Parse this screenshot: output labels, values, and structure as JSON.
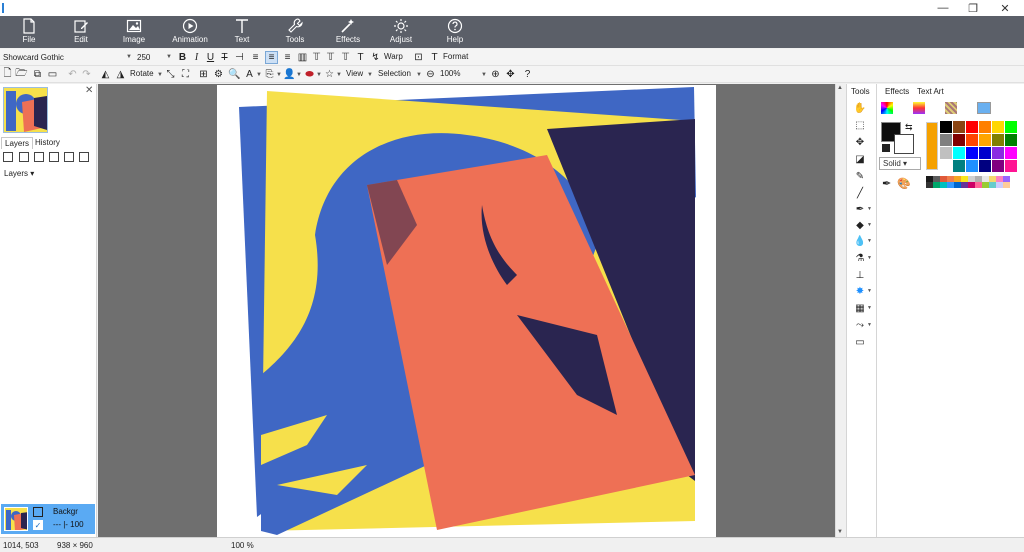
{
  "window": {
    "min_glyph": "—",
    "max_glyph": "❐",
    "close_glyph": "✕"
  },
  "menu": {
    "items": [
      {
        "label": "File",
        "icon": "file-icon"
      },
      {
        "label": "Edit",
        "icon": "edit-icon"
      },
      {
        "label": "Image",
        "icon": "image-icon"
      },
      {
        "label": "Animation",
        "icon": "play-circle-icon"
      },
      {
        "label": "Text",
        "icon": "text-icon"
      },
      {
        "label": "Tools",
        "icon": "wrench-icon"
      },
      {
        "label": "Effects",
        "icon": "magic-wand-icon"
      },
      {
        "label": "Adjust",
        "icon": "sun-icon"
      },
      {
        "label": "Help",
        "icon": "question-icon"
      }
    ]
  },
  "text_toolbar": {
    "font": "Showcard Gothic",
    "size": "250",
    "warp_label": "Warp",
    "format_label": "Format"
  },
  "main_toolbar": {
    "rotate_label": "Rotate",
    "view_label": "View",
    "selection_label": "Selection",
    "zoom": "100%"
  },
  "left_panel": {
    "tabs": [
      "Layers",
      "History"
    ],
    "layers_dropdown": "Layers",
    "layer": {
      "name": "Backgr",
      "opacity_line": "--- |-  100"
    }
  },
  "right_panel": {
    "tools_header": "Tools",
    "tabs": [
      "Effects",
      "Text Art"
    ],
    "fill_style": "Solid",
    "foreground_color": "#0d0d0d",
    "background_color": "#ffffff",
    "palette": [
      "#000000",
      "#8b4513",
      "#ff0000",
      "#ff7f00",
      "#ffd700",
      "#00ff00",
      "#808080",
      "#800000",
      "#ff4500",
      "#ffa500",
      "#808000",
      "#008000",
      "#c0c0c0",
      "#00ffff",
      "#0000ff",
      "#0000cd",
      "#8a2be2",
      "#ff00ff",
      "#ffffff",
      "#008080",
      "#1e90ff",
      "#000080",
      "#800080",
      "#ff1493"
    ],
    "palette_small": [
      "#1a1a1a",
      "#5c5c5c",
      "#e05a3a",
      "#f07d4a",
      "#f5a623",
      "#f8e71c",
      "#d0d0d0",
      "#b0b0b0",
      "#e8e8e8",
      "#f5d76e",
      "#ff80c0",
      "#9966ff",
      "#333333",
      "#00a86b",
      "#00c0c0",
      "#3399ff",
      "#0066cc",
      "#663399",
      "#cc0066",
      "#ff6699",
      "#99cc33",
      "#66cccc",
      "#ccccff",
      "#ffcc99"
    ]
  },
  "status": {
    "cursor": "1014, 503",
    "dimensions": "938 × 960",
    "zoom": "100 %"
  }
}
